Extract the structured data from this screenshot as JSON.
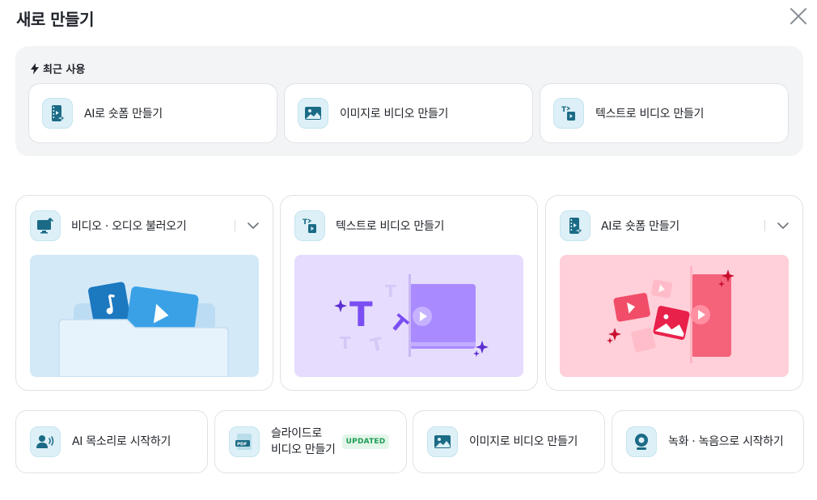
{
  "dialog": {
    "title": "새로 만들기"
  },
  "recent": {
    "heading": "최근 사용",
    "items": [
      {
        "label": "AI로 숏폼 만들기",
        "icon": "ai-shortform-icon"
      },
      {
        "label": "이미지로 비디오 만들기",
        "icon": "image-icon"
      },
      {
        "label": "텍스트로 비디오 만들기",
        "icon": "text-to-video-icon"
      }
    ]
  },
  "cards": [
    {
      "label": "비디오 · 오디오 불러오기",
      "icon": "import-media-icon",
      "has_dropdown": true,
      "art_bg": "#d3e9f8"
    },
    {
      "label": "텍스트로 비디오 만들기",
      "icon": "text-to-video-icon",
      "has_dropdown": false,
      "art_bg": "#e6dcfd"
    },
    {
      "label": "AI로 숏폼 만들기",
      "icon": "ai-shortform-icon",
      "has_dropdown": true,
      "art_bg": "#ffd0d9"
    }
  ],
  "shortcuts": [
    {
      "label": "AI 목소리로 시작하기",
      "icon": "voice-icon"
    },
    {
      "label_line1": "슬라이드로",
      "label_line2": "비디오 만들기",
      "badge": "UPDATED",
      "icon": "pdf-icon"
    },
    {
      "label": "이미지로 비디오 만들기",
      "icon": "image-icon"
    },
    {
      "label": "녹화 · 녹음으로 시작하기",
      "icon": "webcam-icon"
    }
  ],
  "colors": {
    "icon_dark": "#1b6b86",
    "icon_bg": "#ddf0f7",
    "badge_green": "#1f9d55"
  }
}
